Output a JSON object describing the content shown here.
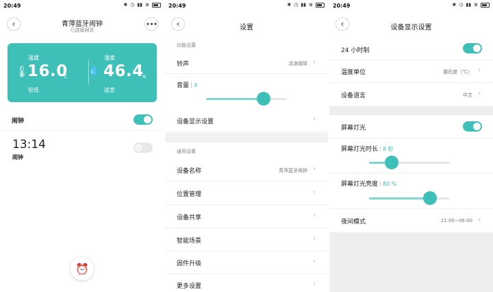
{
  "status": {
    "time": "20:49",
    "icons": [
      "bluetooth-icon",
      "alarm-status-icon",
      "signal-icon",
      "wifi-icon",
      "battery-icon"
    ]
  },
  "colors": {
    "accent": "#3ebfb7",
    "slider_fill": "#7dd6d0",
    "background": "#eeeeee"
  },
  "device": {
    "title": "青萍蓝牙闹钟",
    "subtitle": "已连接网关",
    "temperature": {
      "label": "温度",
      "value": "16.0",
      "unit": "°C",
      "status": "较低"
    },
    "humidity": {
      "label": "湿度",
      "value": "46.4",
      "unit": "%",
      "status": "适宜"
    },
    "alarm_section": {
      "label": "闹钟",
      "enabled": true
    },
    "alarms": [
      {
        "time": "13:14",
        "label": "闹钟",
        "enabled": false
      }
    ]
  },
  "settings": {
    "title": "设置",
    "function_section": "功能设置",
    "ringtone": {
      "label": "铃声",
      "value": "活泼钢琴"
    },
    "volume": {
      "label": "音量",
      "value": "4",
      "fraction": 0.71
    },
    "display_settings": {
      "label": "设备显示设置"
    },
    "general_section": "通用设置",
    "items": [
      {
        "label": "设备名称",
        "value": "青萍蓝牙闹钟"
      },
      {
        "label": "位置管理"
      },
      {
        "label": "设备共享"
      },
      {
        "label": "智能场景"
      },
      {
        "label": "固件升级"
      },
      {
        "label": "更多设置"
      }
    ]
  },
  "display": {
    "title": "设备显示设置",
    "hour24": {
      "label": "24 小时制",
      "enabled": true
    },
    "temp_unit": {
      "label": "温度单位",
      "value": "摄氏度（℃）"
    },
    "language": {
      "label": "设备语言",
      "value": "中文"
    },
    "backlight": {
      "label": "屏幕灯光",
      "enabled": true
    },
    "backlight_duration": {
      "label": "屏幕灯光时长",
      "value": "8 秒",
      "fraction": 0.28
    },
    "backlight_brightness": {
      "label": "屏幕灯光亮度",
      "value": "80 %",
      "fraction": 0.75
    },
    "night_mode": {
      "label": "夜间模式",
      "value": "21:00~06:00"
    }
  }
}
